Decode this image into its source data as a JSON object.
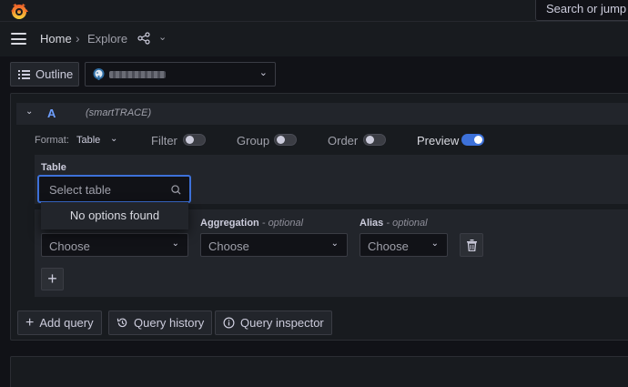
{
  "topbar": {
    "logo_icon": "grafana-logo-icon",
    "search_placeholder": "Search or jump to..."
  },
  "breadcrumb": {
    "home": "Home",
    "separator": "›",
    "current": "Explore"
  },
  "toolbar": {
    "outline_label": "Outline",
    "datasource_icon": "postgres-elephant-icon",
    "datasource_name_redacted": true
  },
  "query": {
    "ref_id": "A",
    "datasource_tag": "(smartTRACE)",
    "format_label": "Format:",
    "format_value": "Table",
    "toggles": [
      {
        "label": "Filter",
        "on": false
      },
      {
        "label": "Group",
        "on": false
      },
      {
        "label": "Order",
        "on": false
      },
      {
        "label": "Preview",
        "on": true
      }
    ],
    "table_label": "Table",
    "table_placeholder": "Select table",
    "dropdown_message": "No options found",
    "aggregation_label": "Aggregation",
    "alias_label": "Alias",
    "optional_suffix": "- optional",
    "column_select": "Choose",
    "aggregation_select": "Choose",
    "alias_select": "Choose"
  },
  "actions": {
    "add_query": "Add query",
    "query_history": "Query history",
    "query_inspector": "Query inspector"
  },
  "colors": {
    "background": "#111217",
    "panel": "#181b1f",
    "accent": "#3d71d9",
    "ref_id": "#6e9fff"
  }
}
